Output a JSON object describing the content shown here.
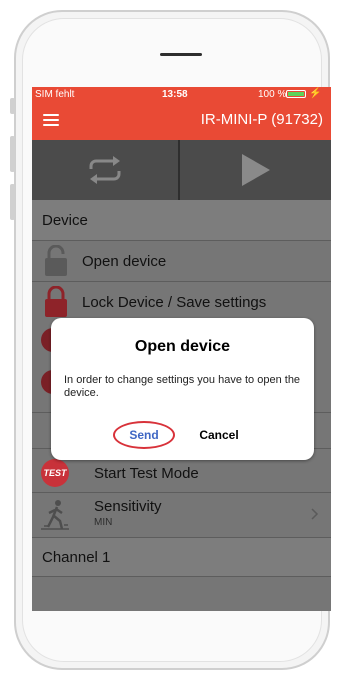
{
  "status_bar": {
    "carrier": "SIM fehlt",
    "time": "13:58",
    "battery": "100 %",
    "battery_icon": "battery-full-icon",
    "charging_icon": "bolt-icon"
  },
  "title_bar": {
    "menu_icon": "hamburger-menu-icon",
    "device_name": "IR-MINI-P  (91732)"
  },
  "toolbar": {
    "left_icon": "repeat-icon",
    "right_icon": "play-icon"
  },
  "list": {
    "section_device": "Device",
    "open_device": {
      "label": "Open device",
      "icon": "unlocked-padlock-icon"
    },
    "lock_device": {
      "label": "Lock Device / Save settings",
      "icon": "locked-padlock-icon"
    },
    "test_mode": {
      "label": "Start Test Mode",
      "icon": "test-badge-icon",
      "badge": "TEST"
    },
    "sensitivity": {
      "label": "Sensitivity",
      "value": "MIN",
      "icon": "walking-person-icon",
      "chevron": "chevron-right-icon"
    },
    "section_channel": "Channel 1"
  },
  "dialog": {
    "title": "Open device",
    "message": "In order to change settings you have to open the device.",
    "send_label": "Send",
    "cancel_label": "Cancel"
  },
  "colors": {
    "header_red": "#e94a35",
    "badge_red": "#c8323a",
    "send_blue": "#3f67c4",
    "highlight_circle": "#d8323a"
  }
}
